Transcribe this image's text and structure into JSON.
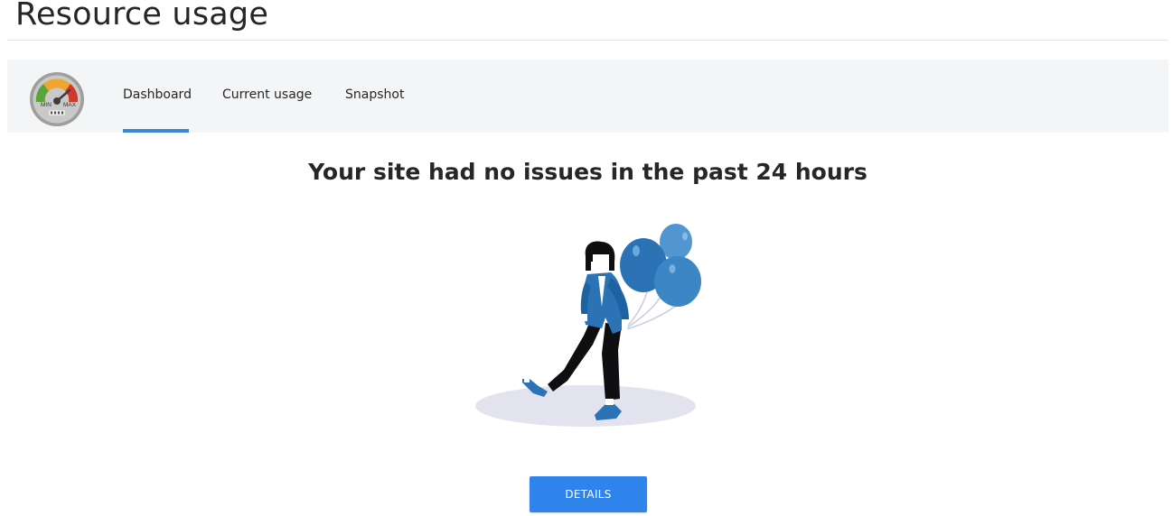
{
  "page": {
    "title": "Resource usage"
  },
  "tabs": [
    {
      "label": "Dashboard",
      "active": true
    },
    {
      "label": "Current usage",
      "active": false
    },
    {
      "label": "Snapshot",
      "active": false
    }
  ],
  "app_icon": {
    "name": "gauge-icon",
    "min_label": "MIN",
    "max_label": "MAX"
  },
  "main": {
    "headline": "Your site had no issues in the past 24 hours",
    "illustration": "woman-with-balloons-illustration",
    "details_button": "DETAILS"
  },
  "colors": {
    "accent": "#3a8ad8",
    "button": "#2f84ec",
    "tabbar_bg": "#f4f5f6",
    "balloon_dark": "#2b73b5",
    "balloon_light": "#4a92d0"
  }
}
